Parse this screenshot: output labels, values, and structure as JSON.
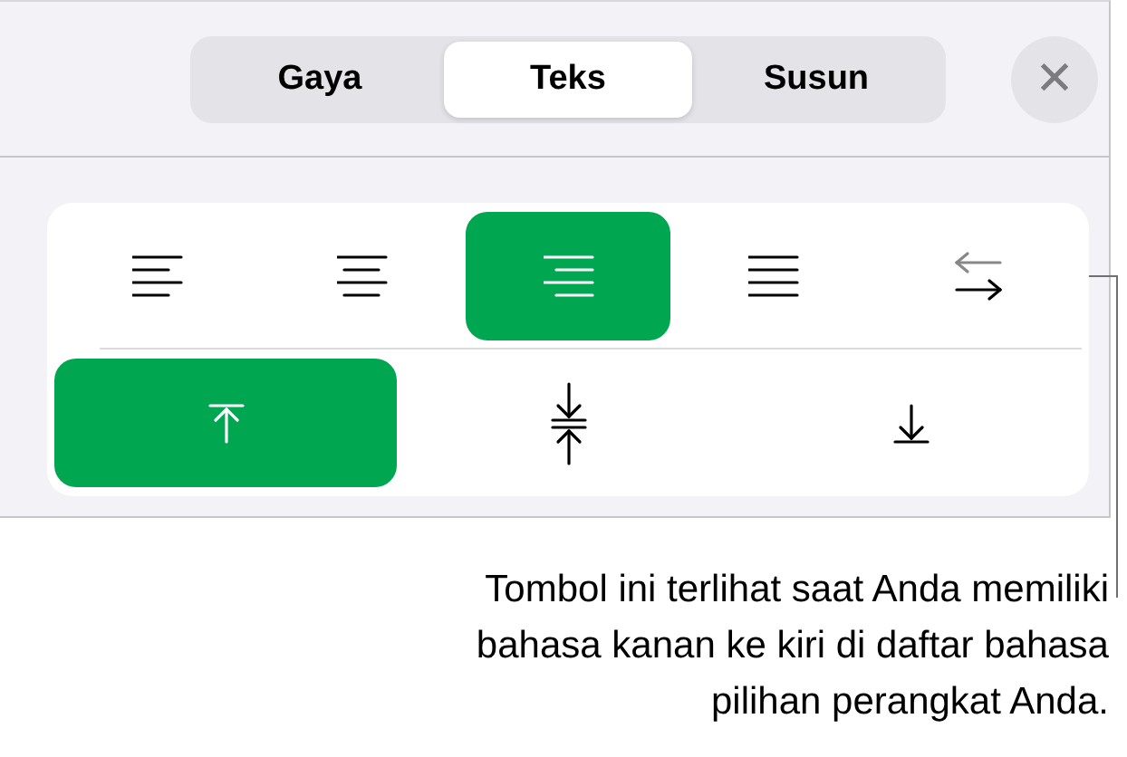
{
  "tabs": [
    {
      "label": "Gaya",
      "selected": false
    },
    {
      "label": "Teks",
      "selected": true
    },
    {
      "label": "Susun",
      "selected": false
    }
  ],
  "close": {
    "label": "✕"
  },
  "alignment": [
    {
      "kind": "left",
      "selected": false
    },
    {
      "kind": "center",
      "selected": false
    },
    {
      "kind": "right",
      "selected": true
    },
    {
      "kind": "justify",
      "selected": false
    },
    {
      "kind": "direction",
      "selected": false
    }
  ],
  "vertical": [
    {
      "kind": "top",
      "selected": true
    },
    {
      "kind": "middle",
      "selected": false
    },
    {
      "kind": "bottom",
      "selected": false
    }
  ],
  "callout": {
    "lines": [
      "Tombol ini terlihat saat Anda memiliki",
      "bahasa kanan ke kiri di daftar bahasa",
      "pilihan perangkat Anda."
    ]
  }
}
